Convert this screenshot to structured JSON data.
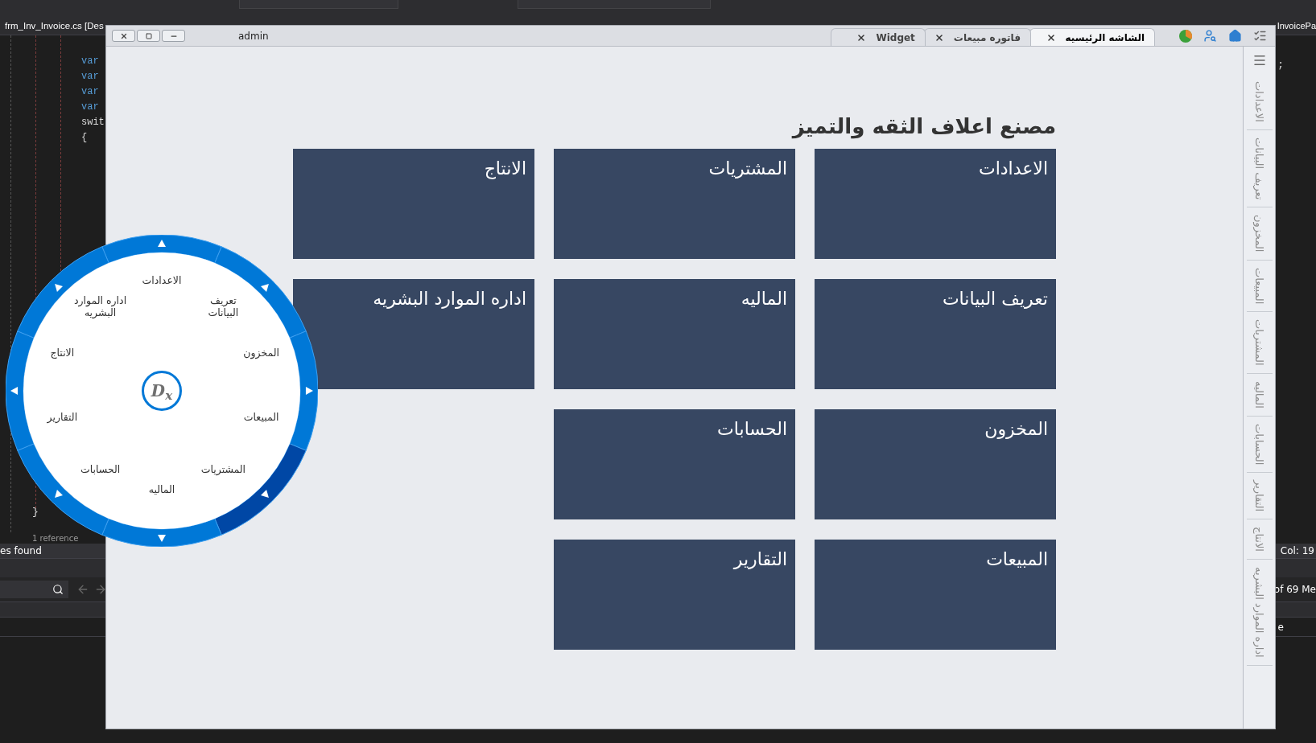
{
  "ide": {
    "document_tab": "frm_Inv_Invoice.cs [Des",
    "document_tab_right": "InvoicePa",
    "code_lines": [
      {
        "kind": "keyword",
        "text": "var"
      },
      {
        "kind": "keyword",
        "text": "var"
      },
      {
        "kind": "keyword",
        "text": "var"
      },
      {
        "kind": "keyword",
        "text": "var"
      },
      {
        "kind": "plain",
        "text": "swit"
      },
      {
        "kind": "plain",
        "text": "{"
      }
    ],
    "code_right": ";",
    "closing_brace": "}",
    "codelens": "1 reference",
    "find_status": "es found",
    "status_column": "Col: 19",
    "results_count": "of 69 Me",
    "row_fragment": "e"
  },
  "window": {
    "title": "admin",
    "tabs": [
      {
        "label": "الشاشه الرئيسيه",
        "selected": true
      },
      {
        "label": "فاتوره مبيعات",
        "selected": false
      },
      {
        "label": "Widget",
        "selected": false
      }
    ],
    "heading": "مصنع اعلاف الثقه والتميز",
    "tile_rows": [
      {
        "tiles": [
          "الاعدادات",
          "المشتريات",
          "الانتاج"
        ]
      },
      {
        "tiles": [
          "تعريف البيانات",
          "الماليه",
          "اداره الموارد البشريه"
        ]
      },
      {
        "tiles": [
          "المخزون",
          "الحسابات"
        ]
      },
      {
        "tiles": [
          "المبيعات",
          "التقارير"
        ]
      }
    ],
    "side_nav": [
      "الاعدادات",
      "تعريف البيانات",
      "المخزون",
      "المبيعات",
      "المشتريات",
      "الماليه",
      "الحسابات",
      "التقارير",
      "الانتاج",
      "اداره الموارد البشريه"
    ]
  },
  "radial_menu": {
    "logo": "D$_{x}$",
    "items": [
      "الاعدادات",
      "تعريف البيانات",
      "المخزون",
      "المبيعات",
      "المشتريات",
      "الماليه",
      "الحسابات",
      "التقارير",
      "الانتاج",
      "اداره الموارد البشريه"
    ],
    "ring_segments": [
      {
        "selected": false
      },
      {
        "selected": false
      },
      {
        "selected": false
      },
      {
        "selected": true
      },
      {
        "selected": false
      },
      {
        "selected": false
      },
      {
        "selected": false
      },
      {
        "selected": false
      }
    ]
  }
}
